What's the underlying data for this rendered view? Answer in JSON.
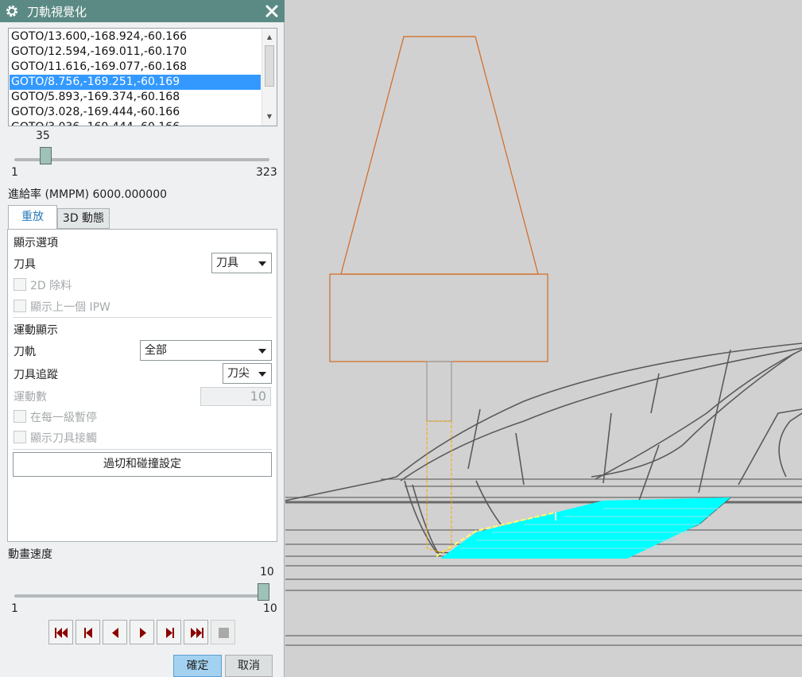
{
  "dialog": {
    "title": "刀軌視覺化",
    "icons": {
      "settings": "gear-icon",
      "close": "close-icon"
    }
  },
  "clsf_list": {
    "rows": [
      "GOTO/13.600,-168.924,-60.166",
      "GOTO/12.594,-169.011,-60.170",
      "GOTO/11.616,-169.077,-60.168",
      "GOTO/8.756,-169.251,-60.169",
      "GOTO/5.893,-169.374,-60.168",
      "GOTO/3.028,-169.444,-60.166",
      "GOTO/3.036,-169.444,-60.166"
    ],
    "selected_index": 3
  },
  "motion_slider": {
    "value": "35",
    "min": "1",
    "max": "323",
    "fraction": 0.1056
  },
  "feedrate": "進給率 (MMPM) 6000.000000",
  "tabs": {
    "replay": "重放",
    "dynamic": "3D 動態"
  },
  "display_options": {
    "heading": "顯示選項",
    "tool_label": "刀具",
    "tool_value": "刀具",
    "remove_2d": "2D 除料",
    "show_prev_ipw": "顯示上一個 IPW"
  },
  "motion_display": {
    "heading": "運動顯示",
    "path_label": "刀軌",
    "path_value": "全部",
    "trace_label": "刀具追蹤",
    "trace_value": "刀尖",
    "count_label": "運動數",
    "count_value": "10",
    "pause_each_level": "在每一級暫停",
    "show_tool_contact": "顯示刀具接觸",
    "collision_button": "過切和碰撞設定"
  },
  "animation_speed": {
    "label": "動畫速度",
    "value": "10",
    "min": "1",
    "max": "10",
    "fraction": 1.0
  },
  "buttons": {
    "ok": "確定",
    "cancel": "取消"
  },
  "colors": {
    "titlebar": "#5b8a84",
    "selection": "#3399ff",
    "tool_outline": "#d2691e",
    "cut_region": "#00ffff",
    "playback_icon": "#8b0000"
  }
}
